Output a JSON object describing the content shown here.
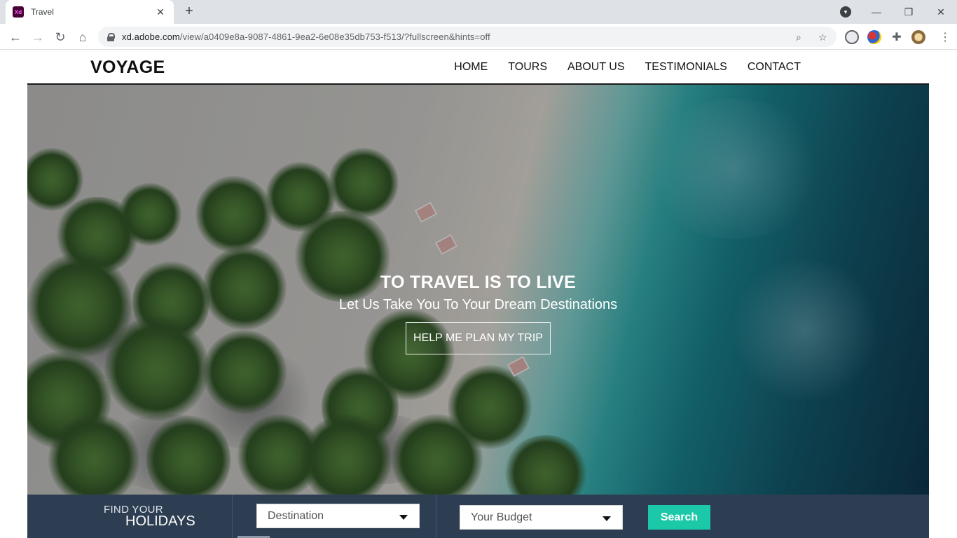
{
  "browser": {
    "tab_title": "Travel",
    "tab_favicon": "Xd",
    "url_host": "xd.adobe.com",
    "url_path": "/view/a0409e8a-9087-4861-9ea2-6e08e35db753-f513/?fullscreen&hints=off",
    "icons": [
      "back-icon",
      "forward-icon",
      "reload-icon",
      "home-icon",
      "lock-icon",
      "zoom-icon",
      "star-icon",
      "extension-icon",
      "puzzle-icon",
      "profile-icon",
      "minimize-icon",
      "restore-icon",
      "close-icon"
    ]
  },
  "site": {
    "logo": "VOYAGE",
    "nav": [
      "HOME",
      "TOURS",
      "ABOUT US",
      "TESTIMONIALS",
      "CONTACT"
    ]
  },
  "hero": {
    "title": "TO TRAVEL IS TO LIVE",
    "subtitle": "Let Us Take You To Your Dream Destinations",
    "cta": "HELP ME PLAN MY TRIP"
  },
  "search": {
    "find_line1": "FIND YOUR",
    "find_line2": "HOLIDAYS",
    "destination_placeholder": "Destination",
    "budget_placeholder": "Your Budget",
    "button": "Search"
  },
  "colors": {
    "accent": "#1bc9a9",
    "searchbar_bg": "#2e3e52",
    "xd_brand": "#470137"
  }
}
